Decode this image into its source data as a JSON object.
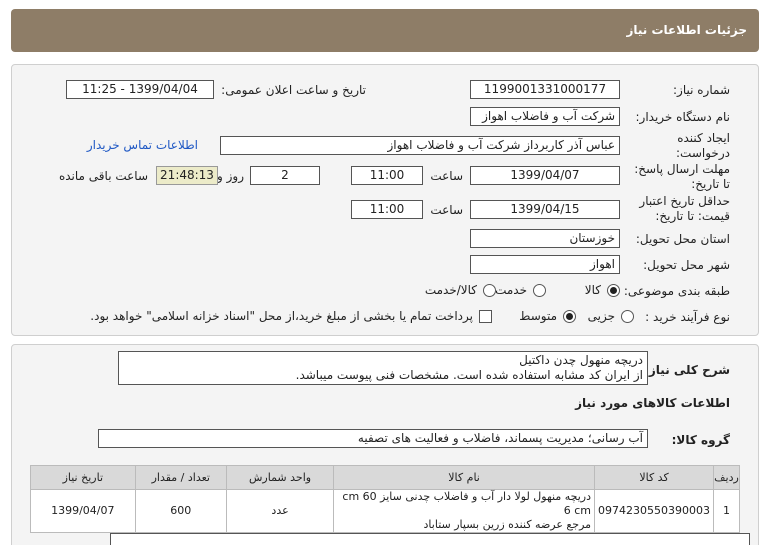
{
  "header": {
    "title": "جزئیات اطلاعات نیاز"
  },
  "form": {
    "need_number_label": "شماره نیاز:",
    "need_number": "1199001331000177",
    "announce_label": "تاریخ و ساعت اعلان عمومی:",
    "announce_value": "1399/04/04 - 11:25",
    "buyer_label": "نام دستگاه خریدار:",
    "buyer_value": "شرکت آب و فاضلاب اهواز",
    "creator_label_1": "ایجاد کننده",
    "creator_label_2": "درخواست:",
    "creator_value": "عباس آذر کاربرداز شرکت آب و فاضلاب اهواز",
    "contact_link": "اطلاعات تماس خریدار",
    "deadline_label_1": "مهلت ارسال پاسخ:",
    "deadline_label_2": "تا تاریخ:",
    "deadline_date": "1399/04/07",
    "time_label": "ساعت",
    "deadline_time": "11:00",
    "days_value": "2",
    "days_label": "روز و",
    "remaining_time": "21:48:13",
    "remaining_label": "ساعت باقی مانده",
    "validity_label_1": "حداقل تاریخ اعتبار",
    "validity_label_2": "قیمت: تا تاریخ:",
    "validity_date": "1399/04/15",
    "validity_time": "11:00",
    "province_label": "استان محل تحویل:",
    "province_value": "خوزستان",
    "city_label": "شهر محل تحویل:",
    "city_value": "اهواز",
    "category_label": "طبقه بندی موضوعی:",
    "category_options": [
      "کالا",
      "خدمت",
      "کالا/خدمت"
    ],
    "process_label": "نوع فرآیند خرید :",
    "process_options": [
      "جزیی",
      "متوسط"
    ],
    "payment_note": "پرداخت تمام یا بخشی از مبلغ خرید،از محل \"اسناد خزانه اسلامی\" خواهد بود."
  },
  "details": {
    "desc_label": "شرح کلی نیاز:",
    "desc_line1": "دریچه منهول چدن داکتیل",
    "desc_line2": "از ایران کد مشابه استفاده شده است. مشخصات فنی پیوست میباشد.",
    "goods_info_title": "اطلاعات کالاهای مورد نیاز",
    "group_label": "گروه کالا:",
    "group_value": "آب رسانی؛ مدیریت پسماند، فاضلاب و فعالیت های تصفیه",
    "table": {
      "headers": [
        "ردیف",
        "کد کالا",
        "نام کالا",
        "واحد شمارش",
        "تعداد / مقدار",
        "تاریخ نیاز"
      ],
      "rows": [
        {
          "row": "1",
          "code": "0974230550390003",
          "name_line1": "دریچه منهول لولا دار آب و فاضلاب چدنی سایز 60 cm 6 cm",
          "name_line2": "مرجع عرضه کننده زرین بسپار ستاباد",
          "unit": "عدد",
          "qty": "600",
          "date": "1399/04/07"
        }
      ]
    }
  }
}
